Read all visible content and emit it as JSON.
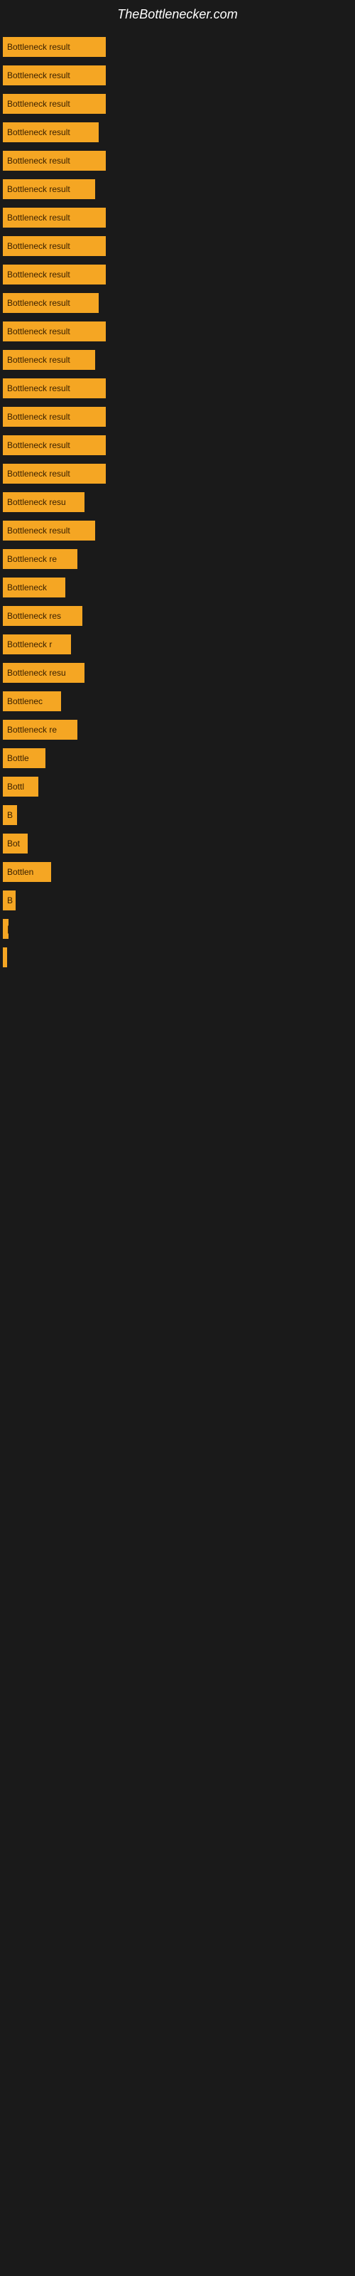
{
  "site": {
    "title": "TheBottlenecker.com"
  },
  "bars": [
    {
      "label": "Bottleneck result",
      "width": 145
    },
    {
      "label": "Bottleneck result",
      "width": 145
    },
    {
      "label": "Bottleneck result",
      "width": 145
    },
    {
      "label": "Bottleneck result",
      "width": 135
    },
    {
      "label": "Bottleneck result",
      "width": 145
    },
    {
      "label": "Bottleneck result",
      "width": 130
    },
    {
      "label": "Bottleneck result",
      "width": 145
    },
    {
      "label": "Bottleneck result",
      "width": 145
    },
    {
      "label": "Bottleneck result",
      "width": 145
    },
    {
      "label": "Bottleneck result",
      "width": 135
    },
    {
      "label": "Bottleneck result",
      "width": 145
    },
    {
      "label": "Bottleneck result",
      "width": 130
    },
    {
      "label": "Bottleneck result",
      "width": 145
    },
    {
      "label": "Bottleneck result",
      "width": 145
    },
    {
      "label": "Bottleneck result",
      "width": 145
    },
    {
      "label": "Bottleneck result",
      "width": 145
    },
    {
      "label": "Bottleneck resu",
      "width": 115
    },
    {
      "label": "Bottleneck result",
      "width": 130
    },
    {
      "label": "Bottleneck re",
      "width": 105
    },
    {
      "label": "Bottleneck",
      "width": 88
    },
    {
      "label": "Bottleneck res",
      "width": 112
    },
    {
      "label": "Bottleneck r",
      "width": 96
    },
    {
      "label": "Bottleneck resu",
      "width": 115
    },
    {
      "label": "Bottlenec",
      "width": 82
    },
    {
      "label": "Bottleneck re",
      "width": 105
    },
    {
      "label": "Bottle",
      "width": 60
    },
    {
      "label": "Bottl",
      "width": 50
    },
    {
      "label": "B",
      "width": 20
    },
    {
      "label": "Bot",
      "width": 35
    },
    {
      "label": "Bottlen",
      "width": 68
    },
    {
      "label": "B",
      "width": 18
    },
    {
      "label": "|",
      "width": 8
    },
    {
      "label": "▌",
      "width": 6
    }
  ]
}
